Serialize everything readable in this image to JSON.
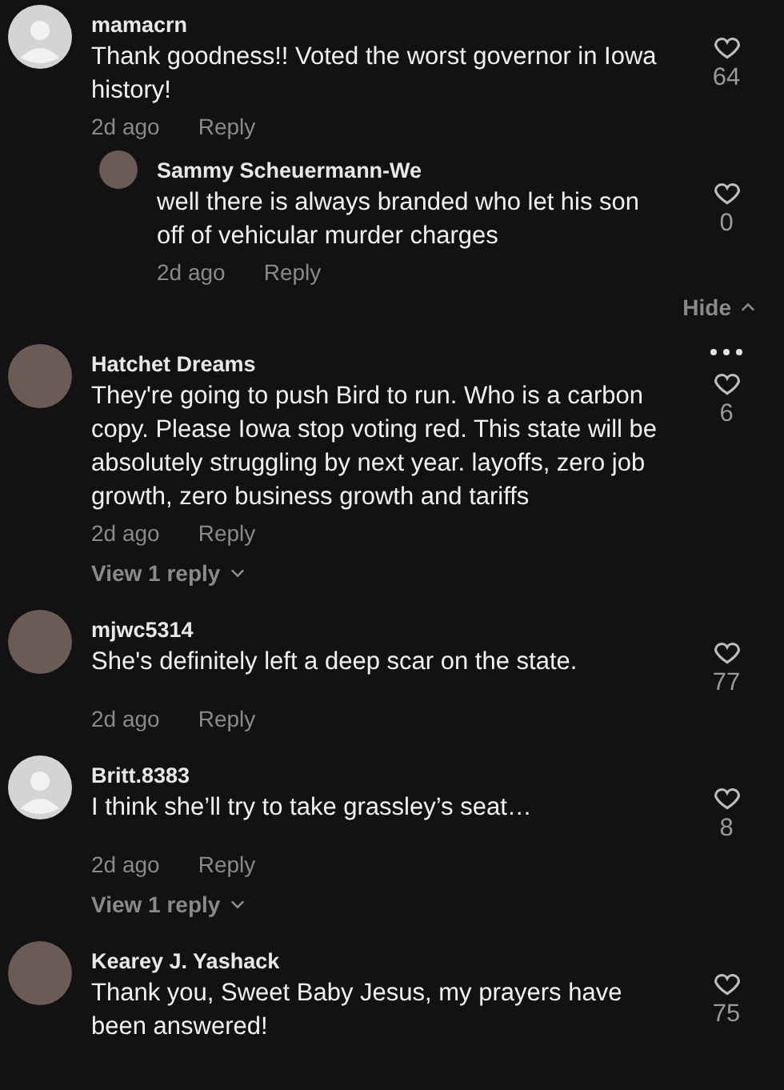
{
  "comments": [
    {
      "avatar": {
        "kind": "default"
      },
      "username": "mamacrn",
      "text": "Thank goodness!! Voted the worst governor in Iowa history!",
      "time": "2d ago",
      "reply": "Reply",
      "likes": "64",
      "more_menu": false,
      "replies": [
        {
          "avatar": {
            "kind": "photo"
          },
          "username": "Sammy Scheuermann-We",
          "text": "well there is always branded who let his son off of vehicular murder charges",
          "time": "2d ago",
          "reply": "Reply",
          "likes": "0"
        }
      ],
      "hide": "Hide"
    },
    {
      "avatar": {
        "kind": "photo"
      },
      "username": "Hatchet Dreams",
      "text": "They're going to push Bird to run. Who is a carbon copy. Please Iowa stop voting red. This state will be absolutely struggling by next year. layoffs, zero job growth, zero business growth and tariffs",
      "time": "2d ago",
      "reply": "Reply",
      "likes": "6",
      "more_menu": true,
      "view_replies": "View 1 reply"
    },
    {
      "avatar": {
        "kind": "photo"
      },
      "username": "mjwc5314",
      "text": "She's definitely left a deep scar on the state.",
      "time": "2d ago",
      "reply": "Reply",
      "likes": "77",
      "more_menu": false
    },
    {
      "avatar": {
        "kind": "default"
      },
      "username": "Britt.8383",
      "text": "I think she’ll try to take grassley’s seat…",
      "time": "2d ago",
      "reply": "Reply",
      "likes": "8",
      "more_menu": false,
      "view_replies": "View 1 reply"
    },
    {
      "avatar": {
        "kind": "photo"
      },
      "username": "Kearey J. Yashack",
      "text": "Thank you, Sweet Baby Jesus, my prayers have been answered!",
      "likes": "75",
      "more_menu": false
    }
  ]
}
